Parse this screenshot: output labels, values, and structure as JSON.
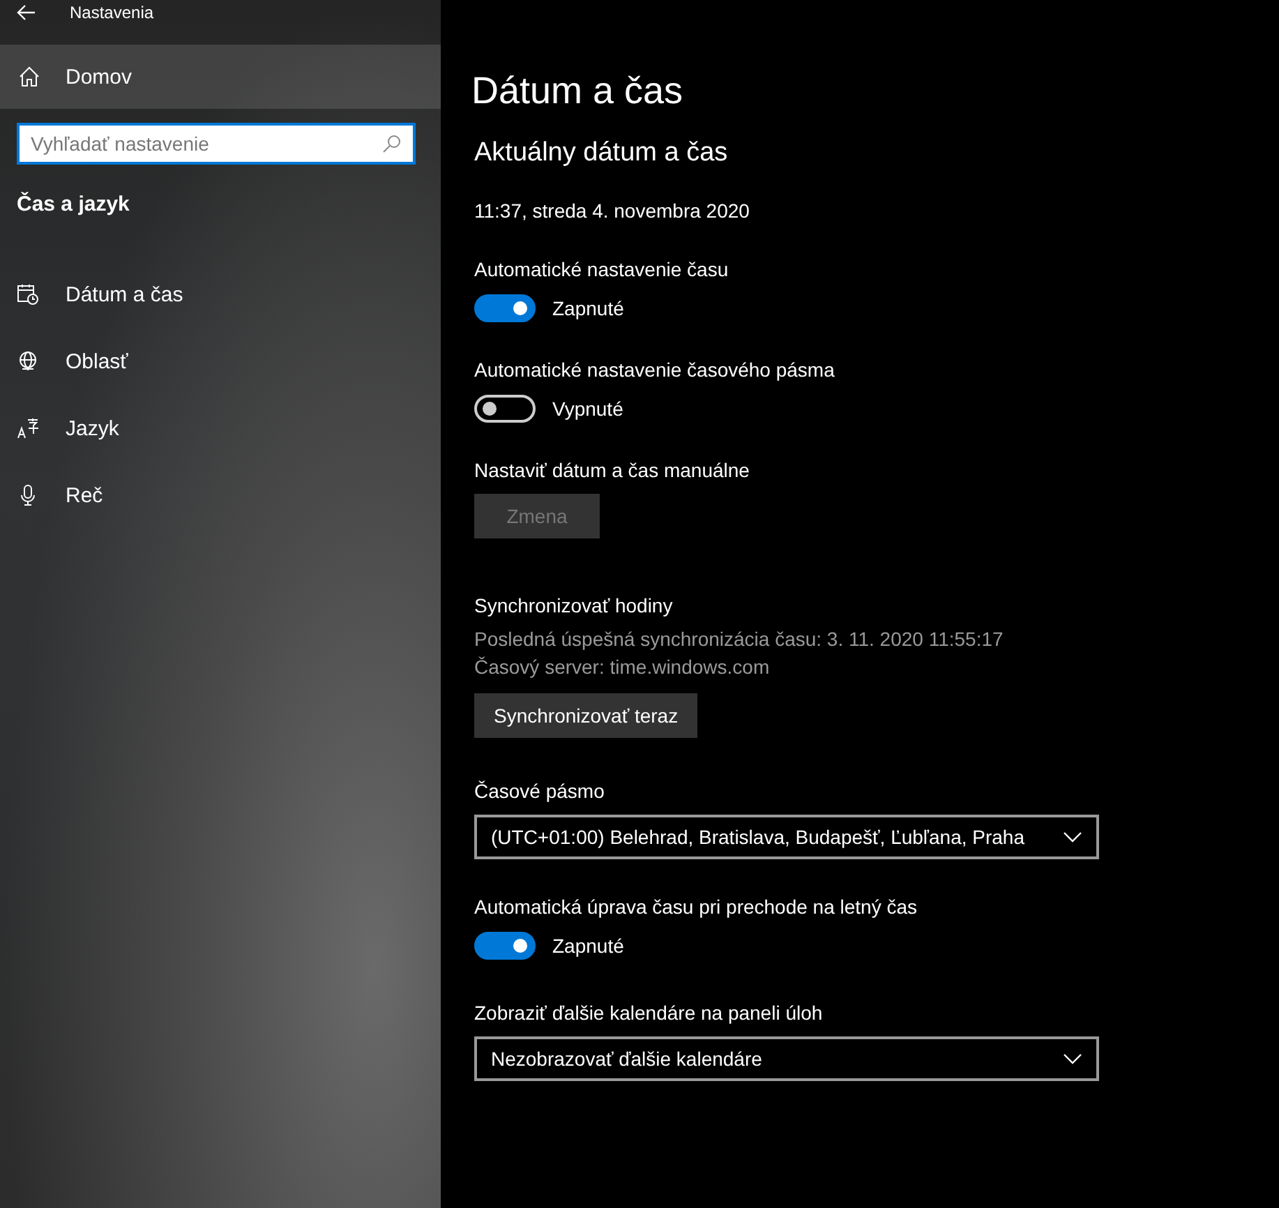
{
  "window": {
    "title": "Nastavenia"
  },
  "sidebar": {
    "home": {
      "label": "Domov",
      "selected": true
    },
    "search": {
      "placeholder": "Vyhľadať nastavenie"
    },
    "category": "Čas a jazyk",
    "items": [
      {
        "label": "Dátum a čas"
      },
      {
        "label": "Oblasť"
      },
      {
        "label": "Jazyk"
      },
      {
        "label": "Reč"
      }
    ]
  },
  "page": {
    "title": "Dátum a čas",
    "section_title": "Aktuálny dátum a čas",
    "current_datetime": "11:37, streda 4. novembra 2020",
    "settings": [
      {
        "kind": "toggle",
        "label": "Automatické nastavenie času",
        "on": true,
        "state_text": "Zapnuté"
      },
      {
        "kind": "toggle",
        "label": "Automatické nastavenie časového pásma",
        "on": false,
        "state_text": "Vypnuté"
      },
      {
        "kind": "button",
        "label": "Nastaviť dátum a čas manuálne",
        "button": "Zmena",
        "disabled": true
      },
      {
        "kind": "sync",
        "label": "Synchronizovať hodiny",
        "lines": [
          "Posledná úspešná synchronizácia času: 3. 11. 2020 11:55:17",
          "Časový server: time.windows.com"
        ],
        "button": "Synchronizovať teraz",
        "disabled": false
      },
      {
        "kind": "dropdown",
        "label": "Časové pásmo",
        "value": "(UTC+01:00) Belehrad, Bratislava, Budapešť, Ľubľana, Praha"
      },
      {
        "kind": "toggle",
        "label": "Automatická úprava času pri prechode na letný čas",
        "on": true,
        "state_text": "Zapnuté"
      },
      {
        "kind": "dropdown",
        "label": "Zobraziť ďalšie kalendáre na paneli úloh",
        "value": "Nezobrazovať ďalšie kalendáre"
      }
    ]
  }
}
